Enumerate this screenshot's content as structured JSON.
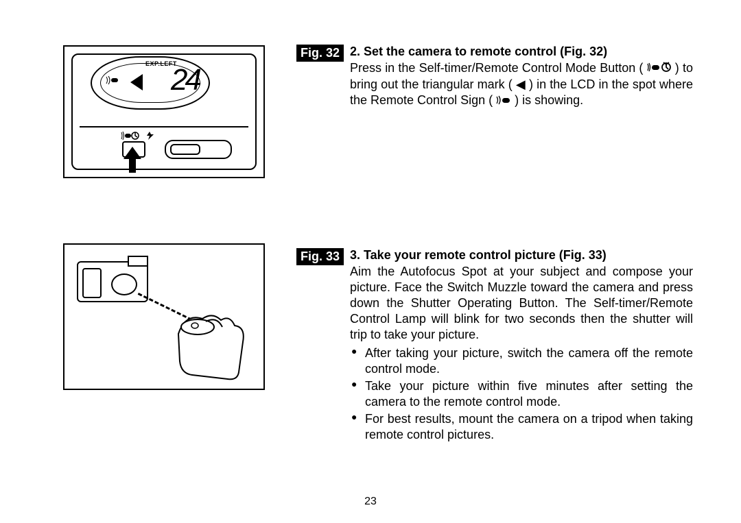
{
  "page_number": "23",
  "fig32": {
    "label": "Fig. 32",
    "lcd_text": "EXP.LEFT",
    "lcd_number": "24",
    "step_title": "2. Set the camera to remote control (Fig. 32)",
    "step_body_1": "Press in the Self-timer/Remote Control Mode Button (",
    "step_body_2": ") to bring out the triangular mark ( ◀ ) in the LCD in the spot where the Remote Control Sign (",
    "step_body_3": ") is showing."
  },
  "fig33": {
    "label": "Fig. 33",
    "step_title": "3. Take your remote control picture (Fig. 33)",
    "step_body": "Aim the Autofocus Spot at your subject and compose your picture. Face the Switch Muzzle toward the camera and press down the Shutter Operating Button. The Self-timer/Remote Control Lamp will blink for two seconds then the shutter will trip to take your picture.",
    "bullets": [
      "After taking your picture, switch the camera off the remote control mode.",
      "Take your picture within five minutes after setting the camera to the remote control mode.",
      "For best results, mount the camera on a tripod when taking remote control pictures."
    ]
  }
}
